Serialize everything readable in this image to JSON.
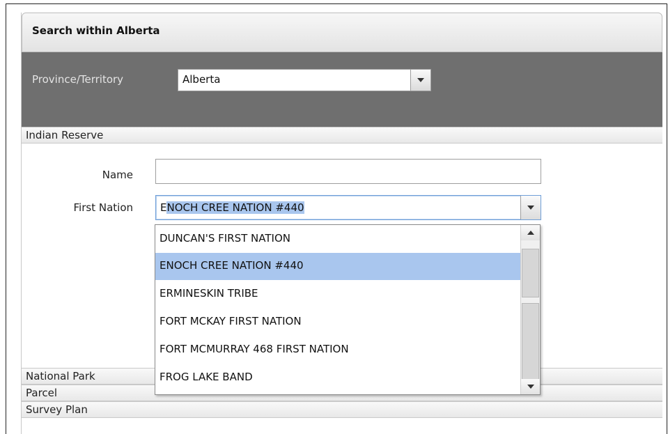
{
  "panel": {
    "title": "Search within Alberta"
  },
  "province": {
    "label": "Province/Territory",
    "value": "Alberta"
  },
  "sections": {
    "indian_reserve": "Indian Reserve",
    "national_park": "National Park",
    "parcel": "Parcel",
    "survey_plan": "Survey Plan"
  },
  "form": {
    "name_label": "Name",
    "name_value": "",
    "first_nation_label": "First Nation",
    "first_nation_value_first": "E",
    "first_nation_value_selected": "NOCH CREE NATION #440"
  },
  "dropdown": {
    "options": [
      "DUNCAN'S FIRST NATION",
      "ENOCH CREE NATION #440",
      "ERMINESKIN TRIBE",
      "FORT MCKAY FIRST NATION",
      "FORT MCMURRAY 468 FIRST NATION",
      "FROG LAKE BAND"
    ],
    "highlighted": "ENOCH CREE NATION #440"
  },
  "colors": {
    "highlight": "#a9c6ee",
    "toolbar": "#6f6f6f"
  },
  "icons": {
    "dropdown_arrow": "chevron-down-icon",
    "scroll_up": "scroll-up-icon",
    "scroll_down": "scroll-down-icon"
  }
}
